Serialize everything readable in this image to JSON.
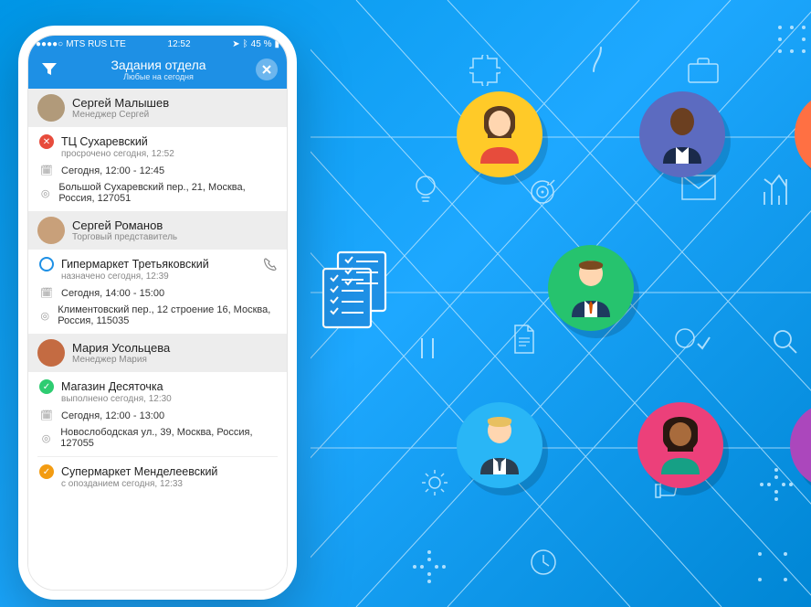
{
  "statusbar": {
    "carrier": "MTS RUS",
    "net": "LTE",
    "time": "12:52",
    "battery": "45 %"
  },
  "header": {
    "title": "Задания отдела",
    "subtitle": "Любые на сегодня"
  },
  "managers": [
    {
      "name": "Сергей Малышев",
      "role": "Менеджер Сергей",
      "avatar_color": "#b19a7a"
    },
    {
      "name": "Сергей Романов",
      "role": "Торговый представитель",
      "avatar_color": "#c8a07a"
    },
    {
      "name": "Мария Усольцева",
      "role": "Менеджер Мария",
      "avatar_color": "#c46b42"
    }
  ],
  "tasks": [
    {
      "status": "red",
      "title": "ТЦ Сухаревский",
      "sub": "просрочено сегодня, 12:52",
      "time": "Сегодня, 12:00 - 12:45",
      "addr": "Большой Сухаревский пер., 21, Москва, Россия, 127051"
    },
    {
      "status": "blue",
      "title": "Гипермаркет Третьяковский",
      "sub": "назначено сегодня, 12:39",
      "time": "Сегодня, 14:00 - 15:00",
      "addr": "Климентовский пер., 12 строение 16, Москва, Россия, 115035",
      "has_call": true
    },
    {
      "status": "green",
      "title": "Магазин Десяточка",
      "sub": "выполнено сегодня, 12:30",
      "time": "Сегодня, 12:00 - 13:00",
      "addr": "Новослободская ул., 39, Москва, Россия, 127055"
    },
    {
      "status": "amber",
      "title": "Супермаркет Менделеевский",
      "sub": "с опозданием сегодня, 12:33"
    }
  ]
}
